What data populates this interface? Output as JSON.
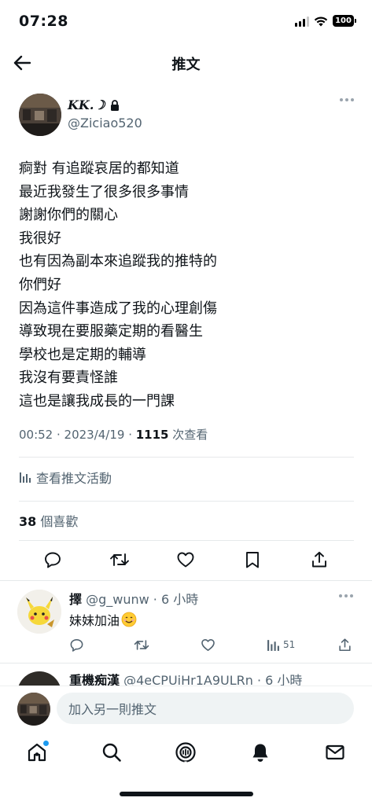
{
  "status_bar": {
    "time": "07:28",
    "battery": "100"
  },
  "header": {
    "title": "推文"
  },
  "tweet": {
    "author_name": "KK.☽",
    "author_handle": "@Ziciao520",
    "lines": [
      "痾對 有追蹤哀居的都知道",
      "最近我發生了很多很多事情",
      "謝謝你們的關心",
      "我很好",
      "也有因為副本來追蹤我的推特的",
      "你們好",
      "因為這件事造成了我的心理創傷",
      "導致現在要服藥定期的看醫生",
      "學校也是定期的輔導",
      "我沒有要責怪誰",
      "這也是讓我成長的一門課"
    ],
    "time_date": "00:52 · 2023/4/19 · ",
    "views": "1115",
    "views_label": " 次查看",
    "activity_label": "查看推文活動",
    "likes_count": "38",
    "likes_label": " 個喜歡"
  },
  "reply": {
    "name": "擇",
    "meta": " @g_wunw · 6 小時",
    "text": "妹妹加油",
    "views": "51"
  },
  "partial_reply": {
    "name": "重機痴漢",
    "meta": " @4eCPUiHr1A9ULRn · 6 小時"
  },
  "compose": {
    "placeholder": "加入另一則推文"
  },
  "colors": {
    "text": "#0f1419",
    "secondary": "#536471",
    "accent": "#1d9bf0",
    "divider": "#e6e9eb"
  },
  "icons": [
    "back-arrow-icon",
    "lock-icon",
    "more-icon",
    "analytics-icon",
    "reply-icon",
    "retweet-icon",
    "like-icon",
    "bookmark-icon",
    "share-icon",
    "home-icon",
    "search-icon",
    "spaces-icon",
    "notifications-icon",
    "messages-icon"
  ]
}
